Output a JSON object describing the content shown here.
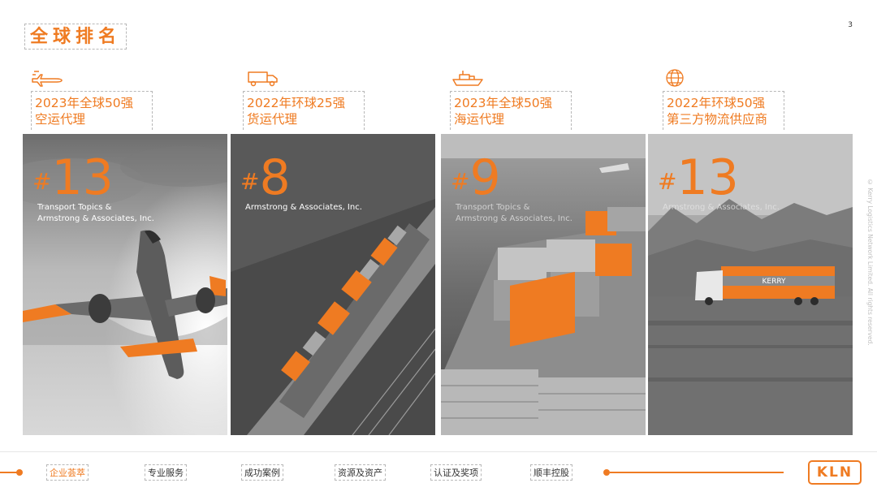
{
  "header": {
    "title": "全球排名",
    "page_number": "3"
  },
  "columns": [
    {
      "icon": "airplane-icon",
      "label_line1": "2023年全球50强",
      "label_line2": "空运代理",
      "rank_hash": "#",
      "rank_number": "13",
      "source_line1": "Transport Topics &",
      "source_line2": "Armstrong & Associates, Inc."
    },
    {
      "icon": "truck-icon",
      "label_line1": "2022年环球25强",
      "label_line2": "货运代理",
      "rank_hash": "#",
      "rank_number": "8",
      "source_line1": "Armstrong & Associates, Inc.",
      "source_line2": ""
    },
    {
      "icon": "ship-icon",
      "label_line1": "2023年全球50强",
      "label_line2": "海运代理",
      "rank_hash": "#",
      "rank_number": "9",
      "source_line1": "Transport Topics &",
      "source_line2": "Armstrong & Associates, Inc."
    },
    {
      "icon": "globe-icon",
      "label_line1": "2022年环球50强",
      "label_line2": "第三方物流供应商",
      "rank_hash": "#",
      "rank_number": "13",
      "source_line1": "Armstrong & Associates, Inc.",
      "source_line2": ""
    }
  ],
  "side_caption": "© Kerry Logistics Network Limited. All rights reserved.",
  "truck_brand": "KERRY",
  "footer": {
    "nav": [
      {
        "label": "企业荟萃",
        "active": true
      },
      {
        "label": "专业服务",
        "active": false
      },
      {
        "label": "成功案例",
        "active": false
      },
      {
        "label": "资源及资产",
        "active": false
      },
      {
        "label": "认证及奖项",
        "active": false
      },
      {
        "label": "顺丰控股",
        "active": false
      }
    ],
    "logo": "KLN"
  },
  "colors": {
    "accent": "#ef7b22",
    "text": "#333333",
    "dashed": "#b8b8b8"
  }
}
